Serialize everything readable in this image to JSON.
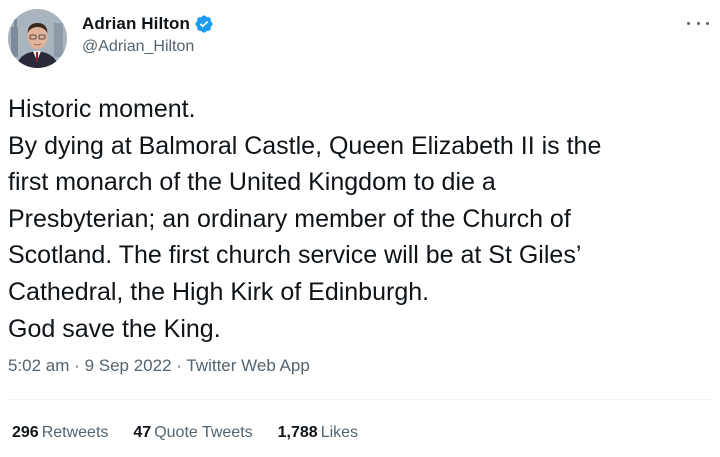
{
  "tweet": {
    "author": {
      "display_name": "Adrian Hilton",
      "handle": "@Adrian_Hilton",
      "verified_icon": "verified-badge-icon"
    },
    "more_icon": "more-options-icon",
    "text_lines": [
      "Historic moment.",
      "By dying at Balmoral Castle, Queen Elizabeth II is the",
      "first monarch of the United Kingdom to die a",
      "Presbyterian; an ordinary member of the Church of",
      "Scotland. The first church service will be at St Giles’",
      "Cathedral, the High Kirk of Edinburgh.",
      "God save the King."
    ],
    "meta": {
      "time": "5:02 am",
      "separator": "·",
      "date": "9 Sep 2022",
      "source": "Twitter Web App"
    },
    "stats": {
      "retweets": {
        "count": "296",
        "label": "Retweets"
      },
      "quote_tweets": {
        "count": "47",
        "label": "Quote Tweets"
      },
      "likes": {
        "count": "1,788",
        "label": "Likes"
      }
    },
    "colors": {
      "verified": "#1d9bf0",
      "text": "#0f1419",
      "secondary": "#536471",
      "divider": "#eff3f4"
    }
  }
}
